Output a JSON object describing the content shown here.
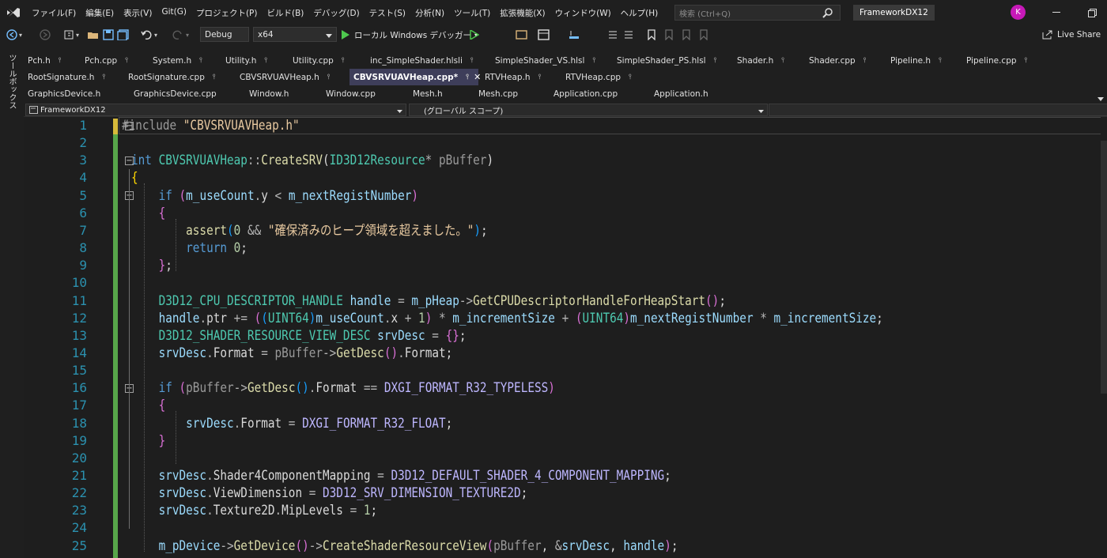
{
  "menu": {
    "items": [
      "ファイル(F)",
      "編集(E)",
      "表示(V)",
      "Git(G)",
      "プロジェクト(P)",
      "ビルド(B)",
      "デバッグ(D)",
      "テスト(S)",
      "分析(N)",
      "ツール(T)",
      "拡張機能(X)",
      "ウィンドウ(W)",
      "ヘルプ(H)"
    ],
    "search_placeholder": "検索 (Ctrl+Q)",
    "solution_name": "FrameworkDX12",
    "avatar_initial": "K"
  },
  "toolbar": {
    "configuration": "Debug",
    "platform": "x64",
    "run_label": "ローカル Windows デバッガー",
    "live_share": "Live Share"
  },
  "toolbox": {
    "label": "ツールボックス"
  },
  "tabs": {
    "row1": [
      "Pch.h",
      "Pch.cpp",
      "System.h",
      "Utility.h",
      "Utility.cpp",
      "inc_SimpleShader.hlsli",
      "SimpleShader_VS.hlsl",
      "SimpleShader_PS.hlsl",
      "Shader.h",
      "Shader.cpp",
      "Pipeline.h",
      "Pipeline.cpp"
    ],
    "row2": [
      "RootSignature.h",
      "RootSignature.cpp",
      "CBVSRVUAVHeap.h",
      "CBVSRVUAVHeap.cpp*",
      "RTVHeap.h",
      "RTVHeap.cpp"
    ],
    "row3": [
      "GraphicsDevice.h",
      "GraphicsDevice.cpp",
      "Window.h",
      "Window.cpp",
      "Mesh.h",
      "Mesh.cpp",
      "Application.cpp",
      "Application.h"
    ],
    "active": "CBVSRVUAVHeap.cpp*"
  },
  "navbar": {
    "project": "FrameworkDX12",
    "scope": "(グローバル スコープ)",
    "member": ""
  },
  "editor": {
    "line_numbers": [
      "1",
      "2",
      "3",
      "4",
      "5",
      "6",
      "7",
      "8",
      "9",
      "10",
      "11",
      "12",
      "13",
      "14",
      "15",
      "16",
      "17",
      "18",
      "19",
      "20",
      "21",
      "22",
      "23",
      "24",
      "25"
    ],
    "lines": [
      [
        [
          "pp",
          "#include "
        ],
        [
          "str",
          "\"CBVSRVUAVHeap.h\""
        ]
      ],
      [],
      [
        [
          "kw",
          "int "
        ],
        [
          "ty",
          "CBVSRVUAVHeap"
        ],
        [
          "op",
          "::"
        ],
        [
          "fn",
          "CreateSRV"
        ],
        [
          "plain",
          "("
        ],
        [
          "ty",
          "ID3D12Resource"
        ],
        [
          "op",
          "* "
        ],
        [
          "par",
          "pBuffer"
        ],
        [
          "plain",
          ")"
        ]
      ],
      [
        [
          "br1",
          "{"
        ]
      ],
      [
        [
          "plain",
          "    "
        ],
        [
          "kw",
          "if "
        ],
        [
          "br2",
          "("
        ],
        [
          "var",
          "m_useCount"
        ],
        [
          "op",
          "."
        ],
        [
          "mem",
          "y "
        ],
        [
          "op",
          "< "
        ],
        [
          "var",
          "m_nextRegistNumber"
        ],
        [
          "br2",
          ")"
        ]
      ],
      [
        [
          "plain",
          "    "
        ],
        [
          "br2",
          "{"
        ]
      ],
      [
        [
          "plain",
          "        "
        ],
        [
          "fn",
          "assert"
        ],
        [
          "br3",
          "("
        ],
        [
          "num",
          "0 "
        ],
        [
          "op",
          "&& "
        ],
        [
          "str",
          "\"確保済みのヒープ領域を超えました。\""
        ],
        [
          "br3",
          ")"
        ],
        [
          "plain",
          ";"
        ]
      ],
      [
        [
          "plain",
          "        "
        ],
        [
          "kw",
          "return "
        ],
        [
          "num",
          "0"
        ],
        [
          "plain",
          ";"
        ]
      ],
      [
        [
          "plain",
          "    "
        ],
        [
          "br2",
          "}"
        ],
        [
          "plain",
          ";"
        ]
      ],
      [],
      [
        [
          "plain",
          "    "
        ],
        [
          "ty",
          "D3D12_CPU_DESCRIPTOR_HANDLE "
        ],
        [
          "var",
          "handle "
        ],
        [
          "op",
          "= "
        ],
        [
          "var",
          "m_pHeap"
        ],
        [
          "op",
          "->"
        ],
        [
          "fn",
          "GetCPUDescriptorHandleForHeapStart"
        ],
        [
          "br2",
          "()"
        ],
        [
          "plain",
          ";"
        ]
      ],
      [
        [
          "plain",
          "    "
        ],
        [
          "var",
          "handle"
        ],
        [
          "op",
          "."
        ],
        [
          "mem",
          "ptr "
        ],
        [
          "op",
          "+= "
        ],
        [
          "br2",
          "("
        ],
        [
          "br3",
          "("
        ],
        [
          "ty",
          "UINT64"
        ],
        [
          "br3",
          ")"
        ],
        [
          "var",
          "m_useCount"
        ],
        [
          "op",
          "."
        ],
        [
          "mem",
          "x "
        ],
        [
          "op",
          "+ "
        ],
        [
          "num",
          "1"
        ],
        [
          "br2",
          ") "
        ],
        [
          "op",
          "* "
        ],
        [
          "var",
          "m_incrementSize "
        ],
        [
          "op",
          "+ "
        ],
        [
          "br2",
          "("
        ],
        [
          "ty",
          "UINT64"
        ],
        [
          "br2",
          ")"
        ],
        [
          "var",
          "m_nextRegistNumber "
        ],
        [
          "op",
          "* "
        ],
        [
          "var",
          "m_incrementSize"
        ],
        [
          "plain",
          ";"
        ]
      ],
      [
        [
          "plain",
          "    "
        ],
        [
          "ty",
          "D3D12_SHADER_RESOURCE_VIEW_DESC "
        ],
        [
          "var",
          "srvDesc "
        ],
        [
          "op",
          "= "
        ],
        [
          "br2",
          "{}"
        ],
        [
          "plain",
          ";"
        ]
      ],
      [
        [
          "plain",
          "    "
        ],
        [
          "var",
          "srvDesc"
        ],
        [
          "op",
          "."
        ],
        [
          "mem",
          "Format "
        ],
        [
          "op",
          "= "
        ],
        [
          "par",
          "pBuffer"
        ],
        [
          "op",
          "->"
        ],
        [
          "fn",
          "GetDesc"
        ],
        [
          "br2",
          "()"
        ],
        [
          "op",
          "."
        ],
        [
          "mem",
          "Format"
        ],
        [
          "plain",
          ";"
        ]
      ],
      [],
      [
        [
          "plain",
          "    "
        ],
        [
          "kw",
          "if "
        ],
        [
          "br2",
          "("
        ],
        [
          "par",
          "pBuffer"
        ],
        [
          "op",
          "->"
        ],
        [
          "fn",
          "GetDesc"
        ],
        [
          "br3",
          "()"
        ],
        [
          "op",
          "."
        ],
        [
          "mem",
          "Format "
        ],
        [
          "op",
          "== "
        ],
        [
          "mac",
          "DXGI_FORMAT_R32_TYPELESS"
        ],
        [
          "br2",
          ")"
        ]
      ],
      [
        [
          "plain",
          "    "
        ],
        [
          "br2",
          "{"
        ]
      ],
      [
        [
          "plain",
          "        "
        ],
        [
          "var",
          "srvDesc"
        ],
        [
          "op",
          "."
        ],
        [
          "mem",
          "Format "
        ],
        [
          "op",
          "= "
        ],
        [
          "mac",
          "DXGI_FORMAT_R32_FLOAT"
        ],
        [
          "plain",
          ";"
        ]
      ],
      [
        [
          "plain",
          "    "
        ],
        [
          "br2",
          "}"
        ]
      ],
      [],
      [
        [
          "plain",
          "    "
        ],
        [
          "var",
          "srvDesc"
        ],
        [
          "op",
          "."
        ],
        [
          "mem",
          "Shader4ComponentMapping "
        ],
        [
          "op",
          "= "
        ],
        [
          "mac",
          "D3D12_DEFAULT_SHADER_4_COMPONENT_MAPPING"
        ],
        [
          "plain",
          ";"
        ]
      ],
      [
        [
          "plain",
          "    "
        ],
        [
          "var",
          "srvDesc"
        ],
        [
          "op",
          "."
        ],
        [
          "mem",
          "ViewDimension "
        ],
        [
          "op",
          "= "
        ],
        [
          "mac",
          "D3D12_SRV_DIMENSION_TEXTURE2D"
        ],
        [
          "plain",
          ";"
        ]
      ],
      [
        [
          "plain",
          "    "
        ],
        [
          "var",
          "srvDesc"
        ],
        [
          "op",
          "."
        ],
        [
          "mem",
          "Texture2D"
        ],
        [
          "op",
          "."
        ],
        [
          "mem",
          "MipLevels "
        ],
        [
          "op",
          "= "
        ],
        [
          "num",
          "1"
        ],
        [
          "plain",
          ";"
        ]
      ],
      [],
      [
        [
          "plain",
          "    "
        ],
        [
          "var",
          "m_pDevice"
        ],
        [
          "op",
          "->"
        ],
        [
          "fn",
          "GetDevice"
        ],
        [
          "br2",
          "()"
        ],
        [
          "op",
          "->"
        ],
        [
          "fn",
          "CreateShaderResourceView"
        ],
        [
          "br2",
          "("
        ],
        [
          "par",
          "pBuffer"
        ],
        [
          "plain",
          ", "
        ],
        [
          "op",
          "&"
        ],
        [
          "var",
          "srvDesc"
        ],
        [
          "plain",
          ", "
        ],
        [
          "var",
          "handle"
        ],
        [
          "br2",
          ")"
        ],
        [
          "plain",
          ";"
        ]
      ]
    ]
  }
}
